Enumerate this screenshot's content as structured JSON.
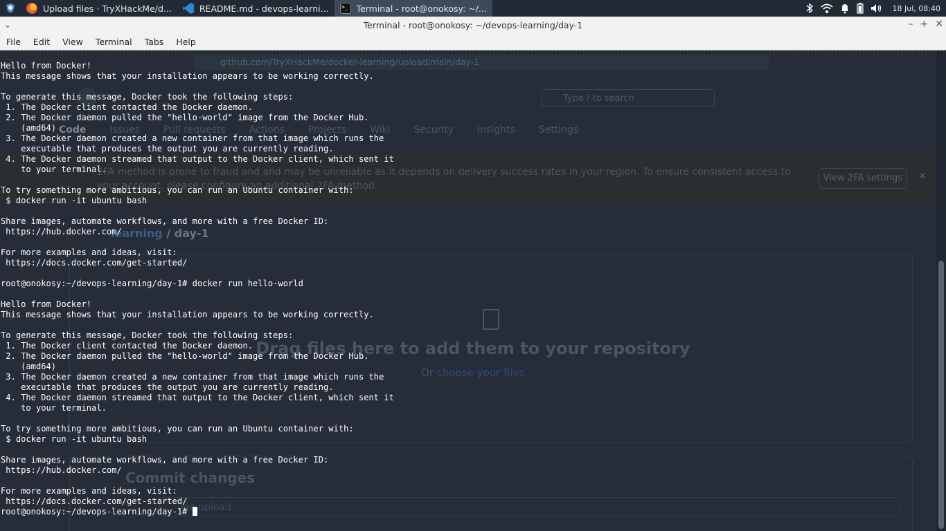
{
  "taskbar": {
    "tasks": [
      {
        "label": "Upload files · TryXHackMe/d...",
        "icon": "firefox-icon",
        "color": "#e8642b"
      },
      {
        "label": "README.md - devops-learni...",
        "icon": "vscode-icon",
        "color": "#2a8ad8"
      },
      {
        "label": "Terminal - root@onokosy: ~/...",
        "icon": "terminal-icon",
        "color": "#1a1a1a"
      }
    ],
    "clock": "18 Jul, 08:40"
  },
  "window": {
    "title": "Terminal - root@onokosy: ~/devops-learning/day-1",
    "menu": [
      "File",
      "Edit",
      "View",
      "Terminal",
      "Tabs",
      "Help"
    ]
  },
  "background_browser": {
    "url": "github.com/TryXHackMe/docker-learning/upload/main/day-1",
    "search_placeholder": "Type / to search",
    "nav": [
      "Code",
      "Issues",
      "Pull requests",
      "Actions",
      "Projects",
      "Wiki",
      "Security",
      "Insights",
      "Settings"
    ],
    "banner": "2FA method is prone to fraud and and may be unreliable as it depends on delivery success rates in your region. To ensure consistent access to your account, please configure an additional 2FA method.",
    "banner_button": "View 2FA settings",
    "breadcrumb_repo": "learning",
    "breadcrumb_sep": " / ",
    "breadcrumb_dir": "day-1",
    "drop_title": "Drag files here to add them to your repository",
    "drop_sub_prefix": "Or ",
    "drop_sub_link": "choose your files",
    "commit_title": "Commit changes",
    "commit_placeholder": "via upload"
  },
  "terminal": {
    "output": "Hello from Docker!\nThis message shows that your installation appears to be working correctly.\n\nTo generate this message, Docker took the following steps:\n 1. The Docker client contacted the Docker daemon.\n 2. The Docker daemon pulled the \"hello-world\" image from the Docker Hub.\n    (amd64)\n 3. The Docker daemon created a new container from that image which runs the\n    executable that produces the output you are currently reading.\n 4. The Docker daemon streamed that output to the Docker client, which sent it\n    to your terminal.\n\nTo try something more ambitious, you can run an Ubuntu container with:\n $ docker run -it ubuntu bash\n\nShare images, automate workflows, and more with a free Docker ID:\n https://hub.docker.com/\n\nFor more examples and ideas, visit:\n https://docs.docker.com/get-started/\n\nroot@onokosy:~/devops-learning/day-1# docker run hello-world\n\nHello from Docker!\nThis message shows that your installation appears to be working correctly.\n\nTo generate this message, Docker took the following steps:\n 1. The Docker client contacted the Docker daemon.\n 2. The Docker daemon pulled the \"hello-world\" image from the Docker Hub.\n    (amd64)\n 3. The Docker daemon created a new container from that image which runs the\n    executable that produces the output you are currently reading.\n 4. The Docker daemon streamed that output to the Docker client, which sent it\n    to your terminal.\n\nTo try something more ambitious, you can run an Ubuntu container with:\n $ docker run -it ubuntu bash\n\nShare images, automate workflows, and more with a free Docker ID:\n https://hub.docker.com/\n\nFor more examples and ideas, visit:\n https://docs.docker.com/get-started/\n",
    "prompt": "root@onokosy:~/devops-learning/day-1# "
  }
}
